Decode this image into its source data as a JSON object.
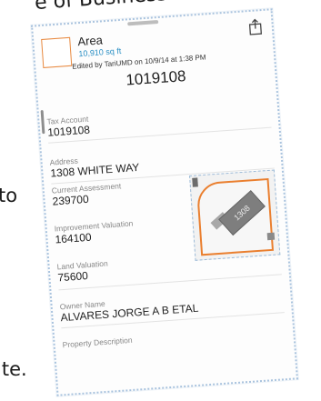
{
  "background": {
    "top_text": "e of Business",
    "left_text": "to",
    "bottom_text": "ite."
  },
  "popup": {
    "title": "Area",
    "subtitle": "10,910 sq ft",
    "edited_by": "Edited by TariUMD on 10/9/14 at 1:38 PM",
    "record_id": "1019108",
    "share_icon": "share-icon",
    "swatch_color": "#e8893f",
    "fields": [
      {
        "label": "Tax Account",
        "value": "1019108"
      },
      {
        "label": "Address",
        "value": "1308 WHITE  WAY"
      },
      {
        "label": "Current Assessment",
        "value": "239700"
      },
      {
        "label": "Improvement Valuation",
        "value": "164100"
      },
      {
        "label": "Land Valuation",
        "value": "75600"
      },
      {
        "label": "Owner Name",
        "value": "ALVARES JORGE A B ETAL"
      },
      {
        "label": "Property Description",
        "value": ""
      }
    ],
    "map": {
      "building_label": "1308",
      "parcel_color": "#ea7f2f"
    }
  }
}
